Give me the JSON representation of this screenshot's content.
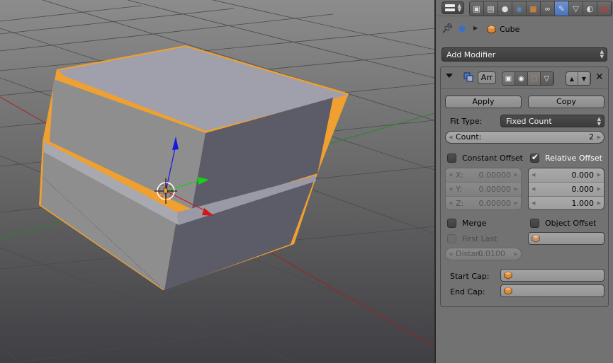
{
  "viewport": {
    "object_name": "Cube",
    "colors": {
      "selection_outline": "#f0a030",
      "x_axis": "#c01818",
      "y_axis": "#208a20",
      "z_axis": "#1818e0"
    }
  },
  "properties": {
    "context_tabs": [
      {
        "icon": "render-icon",
        "glyph": "▣"
      },
      {
        "icon": "render-layers-icon",
        "glyph": "▤"
      },
      {
        "icon": "scene-icon",
        "glyph": "●"
      },
      {
        "icon": "world-icon",
        "glyph": "◉"
      },
      {
        "icon": "object-icon",
        "glyph": "■"
      },
      {
        "icon": "constraints-icon",
        "glyph": "∞"
      },
      {
        "icon": "modifiers-wrench-icon",
        "glyph": "✎",
        "active": true
      },
      {
        "icon": "object-data-icon",
        "glyph": "▽"
      },
      {
        "icon": "material-icon",
        "glyph": "◐"
      },
      {
        "icon": "texture-icon",
        "glyph": "▦"
      }
    ],
    "breadcrumb": {
      "object_name": "Cube"
    },
    "add_modifier_label": "Add Modifier",
    "modifier": {
      "name": "Arr",
      "apply_label": "Apply",
      "copy_label": "Copy",
      "fit_type_label": "Fit Type:",
      "fit_type_value": "Fixed Count",
      "count_label": "Count:",
      "count_value": "2",
      "constant_offset": {
        "label": "Constant Offset",
        "checked": false,
        "x_label": "X:",
        "x_value": "0.00000",
        "y_label": "Y:",
        "y_value": "0.00000",
        "z_label": "Z:",
        "z_value": "0.00000"
      },
      "relative_offset": {
        "label": "Relative Offset",
        "checked": true,
        "x_value": "0.000",
        "y_value": "0.000",
        "z_value": "1.000"
      },
      "merge": {
        "label": "Merge",
        "checked": false
      },
      "first_last": {
        "label": "First Last",
        "checked": false
      },
      "distance": {
        "label": "Distan:",
        "value": "0.0100"
      },
      "object_offset": {
        "label": "Object Offset",
        "checked": false
      },
      "start_cap_label": "Start Cap:",
      "end_cap_label": "End Cap:"
    }
  }
}
